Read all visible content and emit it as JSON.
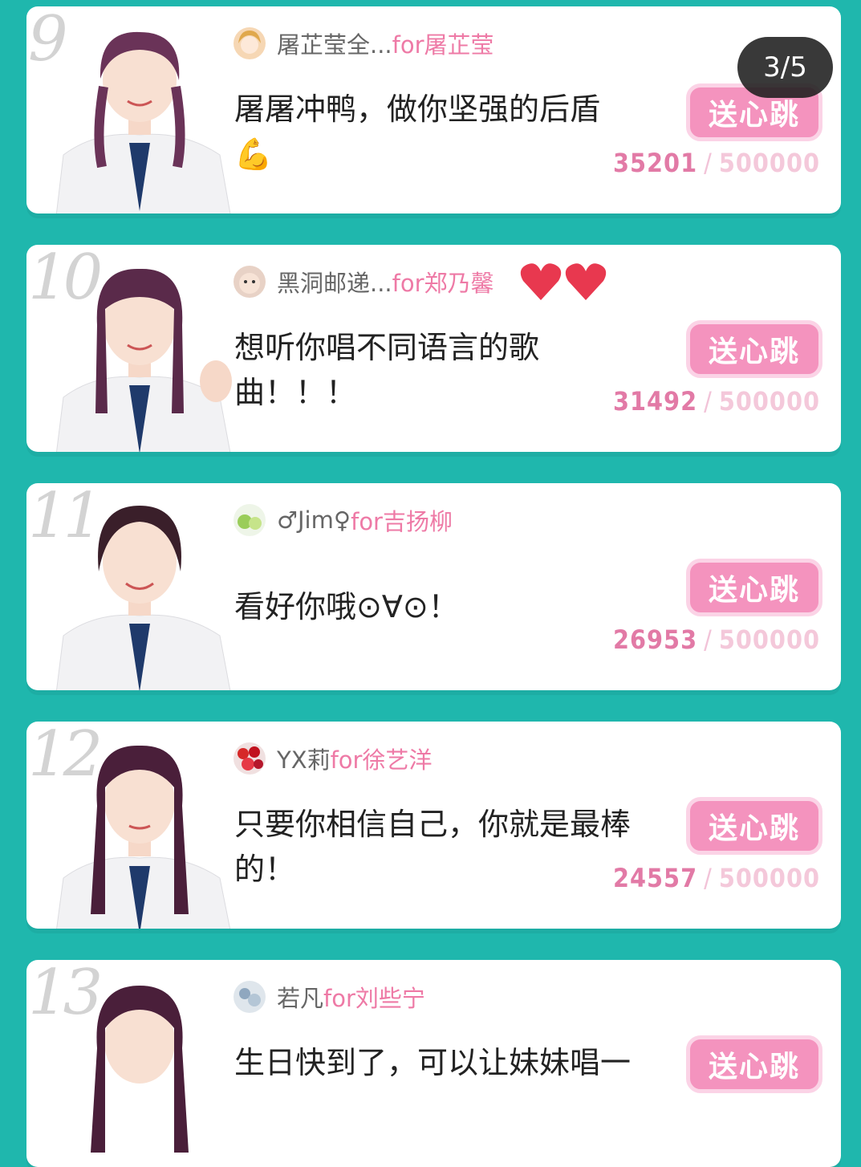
{
  "page_indicator": "3/5",
  "button_label": "送心跳",
  "colors": {
    "background": "#1fb7ad",
    "accent_pink": "#f493be",
    "for_text": "#ee7aa6"
  },
  "cards": [
    {
      "rank": "9",
      "author": "屠芷莹全...",
      "for_text": "for屠芷莹",
      "message": "屠屠冲鸭，做你坚强的后盾",
      "emoji": "💪",
      "current": "35201",
      "separator": "/",
      "total": "500000",
      "avatar_icon": "girl-avatar-icon"
    },
    {
      "rank": "10",
      "author": "黑洞邮递...",
      "for_text": "for郑乃馨",
      "message": "想听你唱不同语言的歌曲！！！",
      "current": "31492",
      "separator": "/",
      "total": "500000",
      "avatar_icon": "baby-avatar-icon"
    },
    {
      "rank": "11",
      "author": "♂Jim♀",
      "for_text": "for吉扬柳",
      "message": "看好你哦⊙∀⊙！",
      "current": "26953",
      "separator": "/",
      "total": "500000",
      "avatar_icon": "fruit-avatar-icon"
    },
    {
      "rank": "12",
      "author": "YX莉",
      "for_text": "for徐艺洋",
      "message": "只要你相信自己，你就是最棒的！",
      "current": "24557",
      "separator": "/",
      "total": "500000",
      "avatar_icon": "berries-avatar-icon"
    },
    {
      "rank": "13",
      "author": "若凡",
      "for_text": "for刘些宁",
      "message": "生日快到了，可以让妹妹唱一",
      "current": "",
      "separator": "",
      "total": "",
      "avatar_icon": "flowers-avatar-icon"
    }
  ]
}
